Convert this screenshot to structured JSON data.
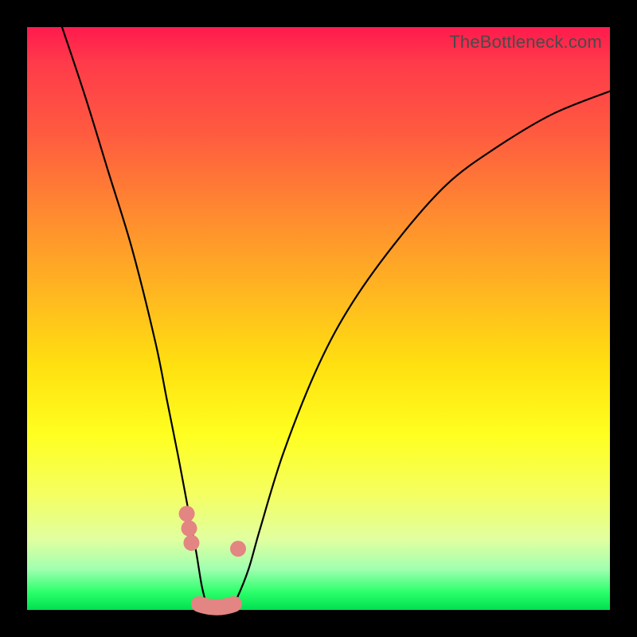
{
  "watermark": "TheBottleneck.com",
  "colors": {
    "frame": "#000000",
    "gradient_top": "#ff1a4d",
    "gradient_mid": "#ffff20",
    "gradient_bottom": "#00e050",
    "curve": "#000000",
    "markers": "#e38582"
  },
  "chart_data": {
    "type": "line",
    "title": "",
    "xlabel": "",
    "ylabel": "",
    "xlim": [
      0,
      100
    ],
    "ylim": [
      0,
      100
    ],
    "series": [
      {
        "name": "bottleneck-curve",
        "x": [
          6,
          10,
          14,
          18,
          22,
          24,
          26,
          27.5,
          29,
          30,
          31,
          32,
          33,
          34,
          35,
          36,
          38,
          40,
          44,
          50,
          56,
          64,
          72,
          80,
          90,
          100
        ],
        "values": [
          100,
          88,
          75,
          62,
          46,
          36,
          26,
          18,
          10,
          4,
          0.5,
          0,
          0,
          0,
          0.5,
          2,
          7,
          14,
          27,
          42,
          53,
          64,
          73,
          79,
          85,
          89
        ]
      }
    ],
    "markers": [
      {
        "x": 27.4,
        "y": 16.5
      },
      {
        "x": 27.8,
        "y": 14.0
      },
      {
        "x": 28.2,
        "y": 11.5
      },
      {
        "x": 36.2,
        "y": 10.5
      }
    ],
    "marker_segment": {
      "x_from": 29.5,
      "x_to": 35.5,
      "y": 1.0
    }
  }
}
